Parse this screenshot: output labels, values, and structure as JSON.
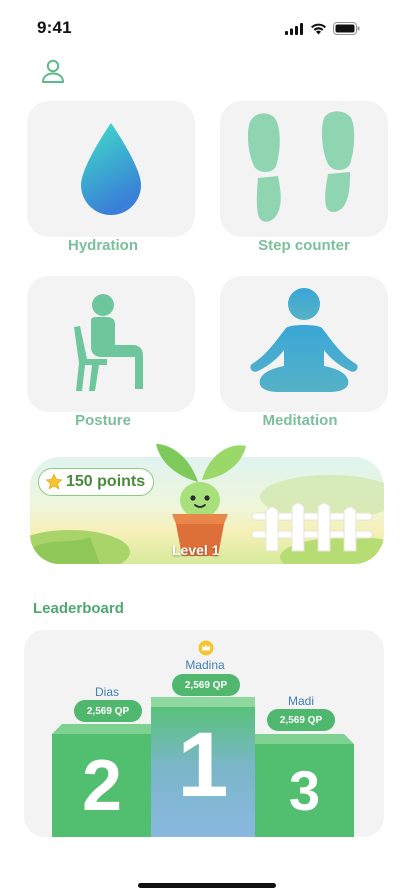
{
  "status_bar": {
    "time": "9:41"
  },
  "icons": {
    "profile": "person-icon",
    "hydration": "water-drop-icon",
    "steps": "footprints-icon",
    "posture": "sitting-person-icon",
    "meditation": "meditation-icon",
    "star": "star-icon",
    "crown": "crown-icon"
  },
  "tiles": {
    "hydration": "Hydration",
    "steps": "Step counter",
    "posture": "Posture",
    "meditation": "Meditation"
  },
  "plant_card": {
    "points": "150 points",
    "level": "Level 1"
  },
  "leaderboard": {
    "title": "Leaderboard",
    "first": {
      "name": "Madina",
      "score": "2,569 QP",
      "rank": "1"
    },
    "second": {
      "name": "Dias",
      "score": "2,569 QP",
      "rank": "2"
    },
    "third": {
      "name": "Madi",
      "score": "2,569 QP",
      "rank": "3"
    }
  },
  "colors": {
    "accent_green": "#50b86e",
    "label_green": "#7cbf9b",
    "podium_blue": "#8ab8e0",
    "name_blue": "#3f7fb4"
  }
}
